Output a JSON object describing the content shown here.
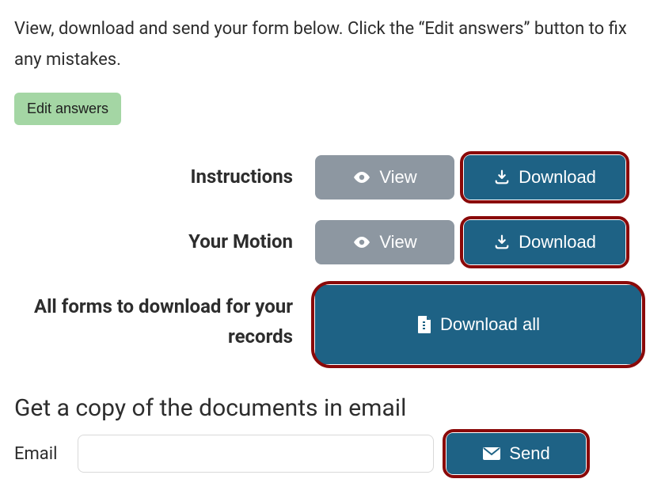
{
  "intro_text": "View, download and send your form below. Click the “Edit answers” button to fix any mistakes.",
  "edit_button_label": "Edit answers",
  "rows": {
    "instructions": {
      "label": "Instructions",
      "view": "View",
      "download": "Download"
    },
    "motion": {
      "label": "Your Motion",
      "view": "View",
      "download": "Download"
    },
    "all": {
      "label": "All forms to download for your records",
      "download_all": "Download all"
    }
  },
  "email_section": {
    "heading": "Get a copy of the documents in email",
    "label": "Email",
    "value": "",
    "send": "Send"
  },
  "colors": {
    "accent": "#1e6285",
    "edit_bg": "#a4d6a4",
    "view_bg": "#8d97a1",
    "highlight_outline": "#8a0909"
  }
}
